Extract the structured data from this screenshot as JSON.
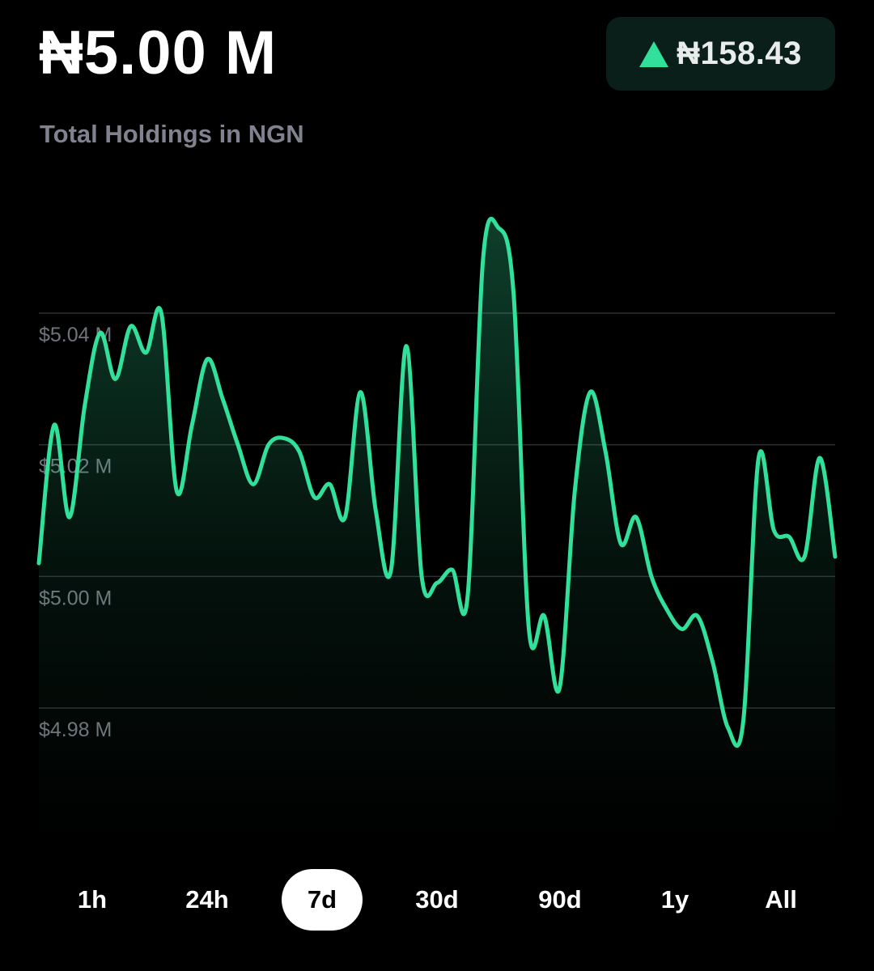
{
  "header": {
    "balance": "₦5.00 M",
    "change_amount": "₦158.43",
    "change_direction_icon": "triangle-up-icon",
    "subtitle": "Total Holdings in NGN"
  },
  "colors": {
    "background": "#000000",
    "accent": "#31e09a",
    "badge_bg": "#0b1f1a",
    "muted_text": "#80838f",
    "gridline": "#2c2f33"
  },
  "timeframes": {
    "items": [
      "1h",
      "24h",
      "7d",
      "30d",
      "90d",
      "1y",
      "All"
    ],
    "selected": "7d"
  },
  "chart_data": {
    "type": "area",
    "y_tick_labels": [
      "$5.04 M",
      "$5.02 M",
      "$5.00 M",
      "$4.98 M"
    ],
    "y_ticks": [
      5.04,
      5.02,
      5.0,
      4.98
    ],
    "ylim": [
      4.97,
      5.06
    ],
    "grid": true,
    "series": [
      {
        "values": [
          5.002,
          5.023,
          5.009,
          5.026,
          5.037,
          5.03,
          5.038,
          5.034,
          5.04,
          5.013,
          5.023,
          5.033,
          5.027,
          5.02,
          5.014,
          5.02,
          5.021,
          5.019,
          5.012,
          5.014,
          5.009,
          5.028,
          5.01,
          5.001,
          5.035,
          5.0,
          4.999,
          5.001,
          4.997,
          5.048,
          5.053,
          5.043,
          4.992,
          4.994,
          4.983,
          5.013,
          5.028,
          5.019,
          5.005,
          5.009,
          5.0,
          4.995,
          4.992,
          4.994,
          4.987,
          4.977,
          4.978,
          5.018,
          5.007,
          5.006,
          5.003,
          5.018,
          5.003
        ]
      }
    ]
  }
}
